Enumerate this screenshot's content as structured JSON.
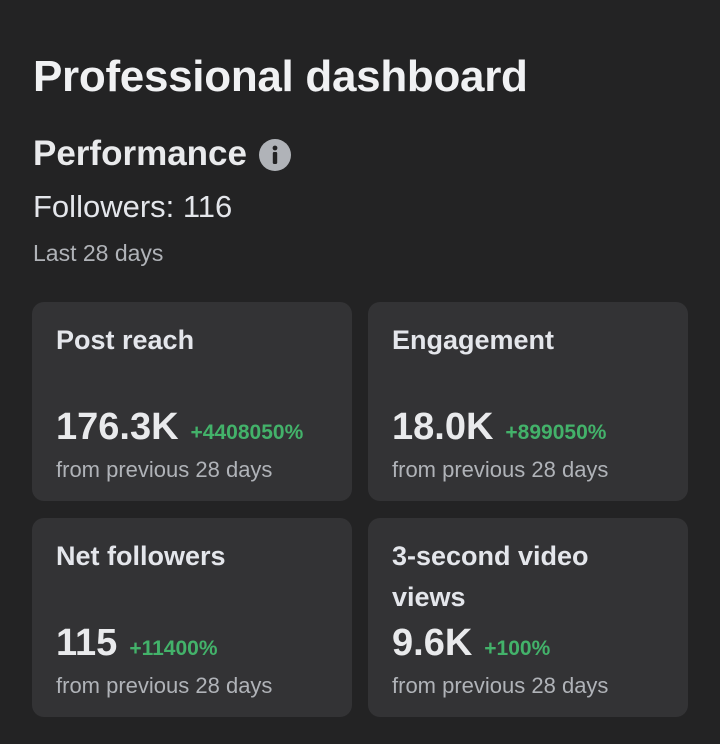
{
  "header": {
    "title": "Professional dashboard"
  },
  "performance": {
    "section_title": "Performance",
    "info_icon": "info-icon",
    "followers_text": "Followers: 116",
    "period_text": "Last 28 days"
  },
  "cards": [
    {
      "label": "Post reach",
      "value": "176.3K",
      "change": "+4408050%",
      "sub": "from previous 28 days"
    },
    {
      "label": "Engagement",
      "value": "18.0K",
      "change": "+899050%",
      "sub": "from previous 28 days"
    },
    {
      "label": "Net followers",
      "value": "115",
      "change": "+11400%",
      "sub": "from previous 28 days"
    },
    {
      "label": "3-second video views",
      "value": "9.6K",
      "change": "+100%",
      "sub": "from previous 28 days"
    }
  ],
  "colors": {
    "background": "#232324",
    "card": "#333335",
    "positive_change": "#43b26a"
  }
}
